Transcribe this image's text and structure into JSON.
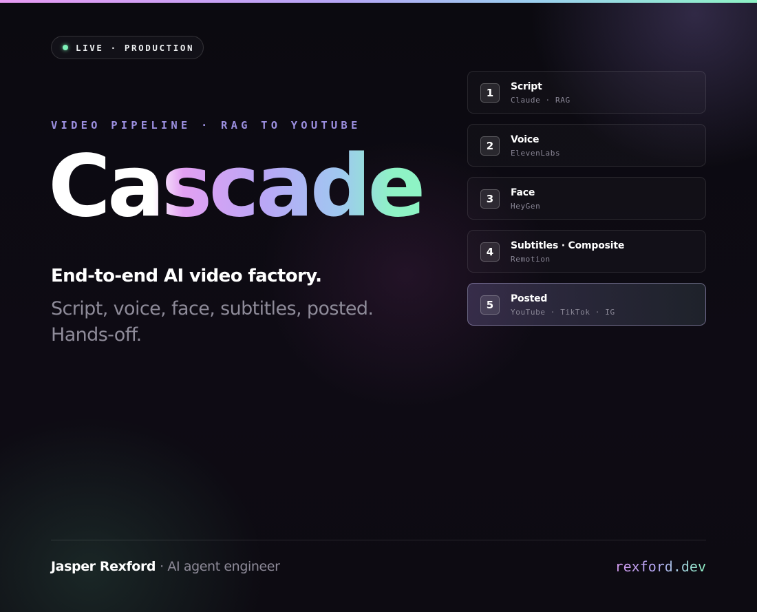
{
  "badge": {
    "status_text": "LIVE · PRODUCTION",
    "dot_color": "#7ef1b8"
  },
  "hero": {
    "eyebrow": "VIDEO PIPELINE · RAG TO YOUTUBE",
    "title": "Cascade",
    "lead": "End-to-end AI video factory.",
    "sub": "Script, voice, face, subtitles, posted. Hands-off."
  },
  "pipeline": {
    "steps": [
      {
        "number": "1",
        "name": "Script",
        "meta": "Claude · RAG"
      },
      {
        "number": "2",
        "name": "Voice",
        "meta": "ElevenLabs"
      },
      {
        "number": "3",
        "name": "Face",
        "meta": "HeyGen"
      },
      {
        "number": "4",
        "name": "Subtitles · Composite",
        "meta": "Remotion"
      },
      {
        "number": "5",
        "name": "Posted",
        "meta": "YouTube · TikTok · IG"
      }
    ],
    "active_step": "5"
  },
  "footer": {
    "author": "Jasper Rexford",
    "role": "· AI agent engineer",
    "site": "rexford.dev"
  },
  "colors": {
    "accent_pink": "#e2a0f2",
    "accent_violet": "#b9a7f6",
    "accent_mint": "#8ef3c5",
    "eyebrow": "#9c8fe0",
    "background": "#0c0a12"
  }
}
